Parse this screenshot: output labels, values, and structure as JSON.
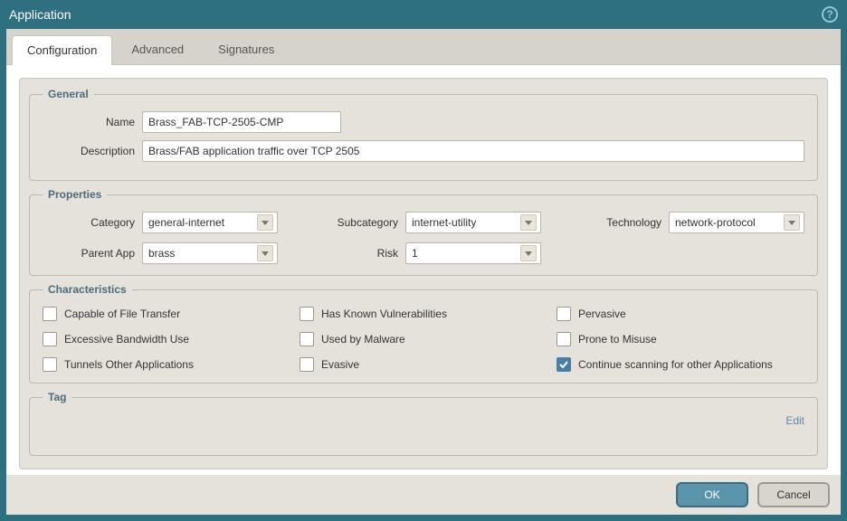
{
  "window": {
    "title": "Application"
  },
  "tabs": {
    "configuration": "Configuration",
    "advanced": "Advanced",
    "signatures": "Signatures"
  },
  "fieldsets": {
    "general": "General",
    "properties": "Properties",
    "characteristics": "Characteristics",
    "tag": "Tag"
  },
  "general": {
    "name_label": "Name",
    "name_value": "Brass_FAB-TCP-2505-CMP",
    "description_label": "Description",
    "description_value": "Brass/FAB application traffic over TCP 2505"
  },
  "properties": {
    "category_label": "Category",
    "category_value": "general-internet",
    "subcategory_label": "Subcategory",
    "subcategory_value": "internet-utility",
    "technology_label": "Technology",
    "technology_value": "network-protocol",
    "parent_app_label": "Parent App",
    "parent_app_value": "brass",
    "risk_label": "Risk",
    "risk_value": "1"
  },
  "characteristics": {
    "file_transfer": "Capable of File Transfer",
    "known_vuln": "Has Known Vulnerabilities",
    "pervasive": "Pervasive",
    "bandwidth": "Excessive Bandwidth Use",
    "malware": "Used by Malware",
    "misuse": "Prone to Misuse",
    "tunnels": "Tunnels Other Applications",
    "evasive": "Evasive",
    "continue_scan": "Continue scanning for other Applications"
  },
  "tag": {
    "edit": "Edit"
  },
  "footer": {
    "ok": "OK",
    "cancel": "Cancel"
  },
  "help_glyph": "?"
}
